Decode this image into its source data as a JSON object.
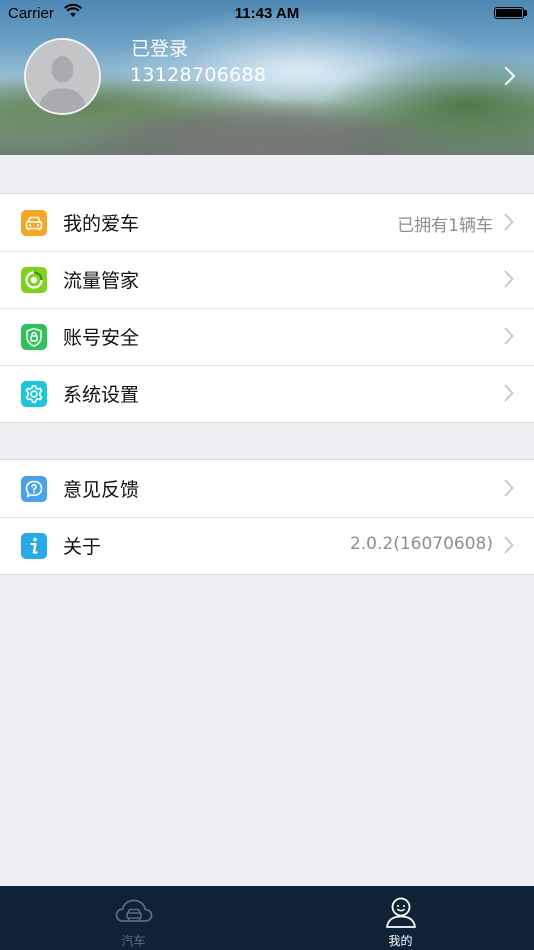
{
  "status_bar": {
    "carrier": "Carrier",
    "time": "11:43 AM"
  },
  "profile": {
    "status": "已登录",
    "phone": "13128706688"
  },
  "menu_groups": [
    {
      "items": [
        {
          "label": "我的爱车",
          "detail": "已拥有1辆车",
          "icon": "car-icon",
          "color": "#f5a623"
        },
        {
          "label": "流量管家",
          "detail": "",
          "icon": "data-flow-icon",
          "color": "#7ed321"
        },
        {
          "label": "账号安全",
          "detail": "",
          "icon": "shield-lock-icon",
          "color": "#2fc15b"
        },
        {
          "label": "系统设置",
          "detail": "",
          "icon": "gear-icon",
          "color": "#1ec6d8"
        }
      ]
    },
    {
      "items": [
        {
          "label": "意见反馈",
          "detail": "",
          "icon": "feedback-question-icon",
          "color": "#4aa3ea"
        },
        {
          "label": "关于",
          "detail": "2.0.2(16070608)",
          "icon": "info-icon",
          "color": "#29a9e8"
        }
      ]
    }
  ],
  "tab_bar": {
    "tabs": [
      {
        "label": "汽车",
        "icon": "car-cloud-icon",
        "selected": false
      },
      {
        "label": "我的",
        "icon": "user-icon",
        "selected": true
      }
    ],
    "background": "#0f2236"
  }
}
